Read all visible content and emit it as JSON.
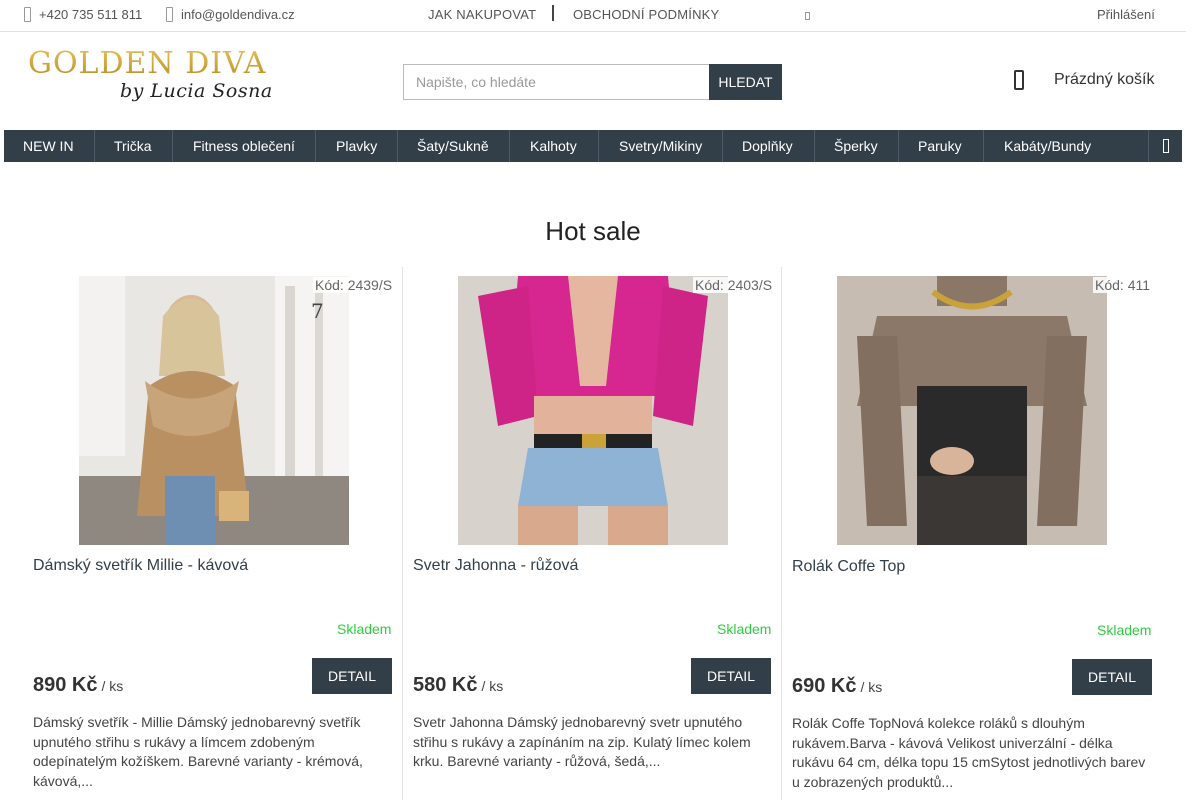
{
  "topbar": {
    "phone": "+420 735 511 811",
    "email": "info@goldendiva.cz",
    "links": [
      "JAK NAKUPOVAT",
      "OBCHODNÍ PODMÍNKY"
    ],
    "login": "Přihlášení"
  },
  "logo": {
    "main": "GOLDEN DIVA",
    "sub": "by Lucia Sosna"
  },
  "search": {
    "placeholder": "Napište, co hledáte",
    "button": "HLEDAT"
  },
  "cart": {
    "label": "Prázdný košík"
  },
  "menu": {
    "items": [
      "NEW IN",
      "Trička",
      "Fitness oblečení",
      "Plavky",
      "Šaty/Sukně",
      "Kalhoty",
      "Svetry/Mikiny",
      "Doplňky",
      "Šperky",
      "Paruky",
      "Kabáty/Bundy"
    ]
  },
  "section": {
    "title": "Hot sale"
  },
  "products": [
    {
      "code": "Kód: 2439/S",
      "name": "Dámský svetřík Millie - kávová",
      "stock": "Skladem",
      "price": "890 Kč",
      "unit": "/ ks",
      "detail": "DETAIL",
      "description": "Dámský svetřík - Millie  Dámský jednobarevný svetřík upnutého střihu s rukávy a límcem zdobeným odepínatelým kožíškem.  Barevné varianty - krémová, kávová,...",
      "image_note": "7"
    },
    {
      "code": "Kód: 2403/S",
      "name": "Svetr Jahonna - růžová",
      "stock": "Skladem",
      "price": "580 Kč",
      "unit": "/ ks",
      "detail": "DETAIL",
      "description": "Svetr Jahonna  Dámský jednobarevný svetr upnutého střihu s rukávy a zapínáním na zip. Kulatý límec kolem krku. Barevné varianty - růžová, šedá,..."
    },
    {
      "code": "Kód: 411",
      "name": "Rolák Coffe Top",
      "stock": "Skladem",
      "price": "690 Kč",
      "unit": "/ ks",
      "detail": "DETAIL",
      "description": "Rolák Coffe TopNová kolekce roláků s dlouhým rukávem.Barva - kávová Velikost univerzální - délka rukávu 64 cm, délka topu 15 cmSytost jednotlivých barev u zobrazených produktů..."
    }
  ],
  "colors": {
    "menu_bg": "#333f48",
    "button_bg": "#333f48",
    "stock_green": "#2ecc40",
    "logo_gold": "#c9a23a"
  }
}
